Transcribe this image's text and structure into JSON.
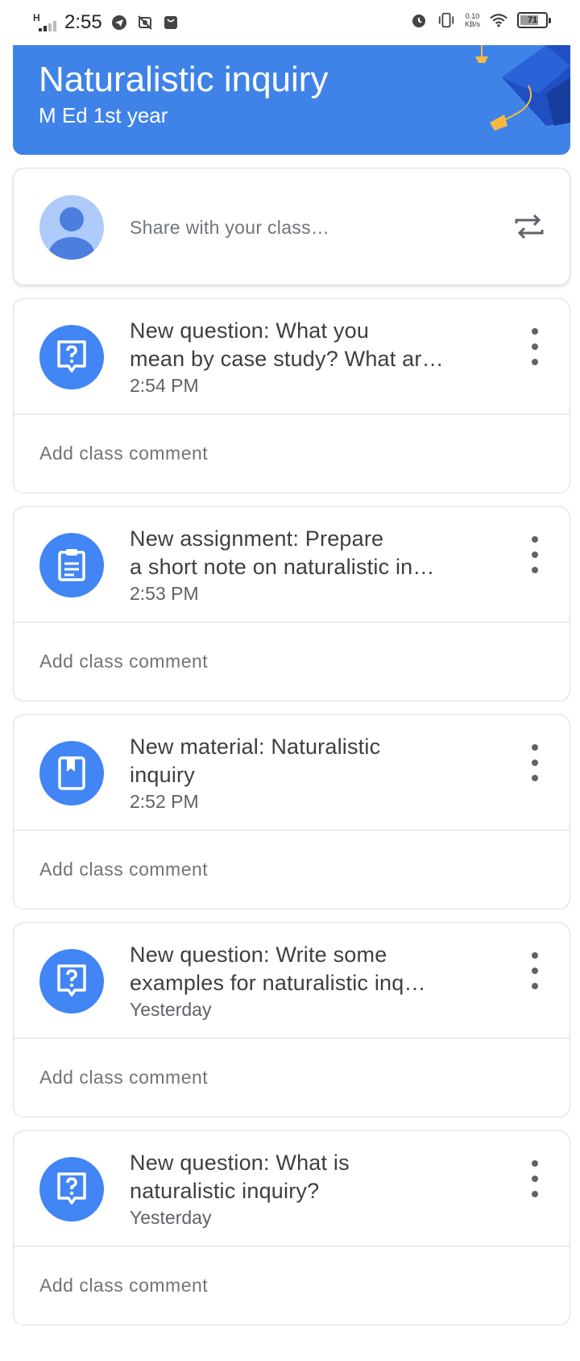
{
  "status_bar": {
    "network": "H",
    "time": "2:55",
    "speed_value": "0.10",
    "speed_unit": "KB/s",
    "battery": "71"
  },
  "class": {
    "title": "Naturalistic inquiry",
    "section": "M Ed 1st year"
  },
  "share": {
    "placeholder": "Share with your class…"
  },
  "stream": [
    {
      "type": "question",
      "icon": "question-icon",
      "title_line1": "New question: What you",
      "title_line2": "mean by case study? What ar…",
      "time": "2:54 PM",
      "comment": "Add class comment"
    },
    {
      "type": "assignment",
      "icon": "assignment-icon",
      "title_line1": "New assignment: Prepare",
      "title_line2": "a short note on naturalistic in…",
      "time": "2:53 PM",
      "comment": "Add class comment"
    },
    {
      "type": "material",
      "icon": "material-icon",
      "title_line1": "New material: Naturalistic",
      "title_line2": "inquiry",
      "time": "2:52 PM",
      "comment": "Add class comment"
    },
    {
      "type": "question",
      "icon": "question-icon",
      "title_line1": "New question: Write some",
      "title_line2": "examples for naturalistic inq…",
      "time": "Yesterday",
      "comment": "Add class comment"
    },
    {
      "type": "question",
      "icon": "question-icon",
      "title_line1": "New question: What is",
      "title_line2": "naturalistic inquiry?",
      "time": "Yesterday",
      "comment": "Add class comment"
    }
  ],
  "colors": {
    "banner": "#3f83e8",
    "icon_circle": "#4285f4",
    "avatar_bg": "#aecbfa",
    "border": "#dadce0"
  }
}
